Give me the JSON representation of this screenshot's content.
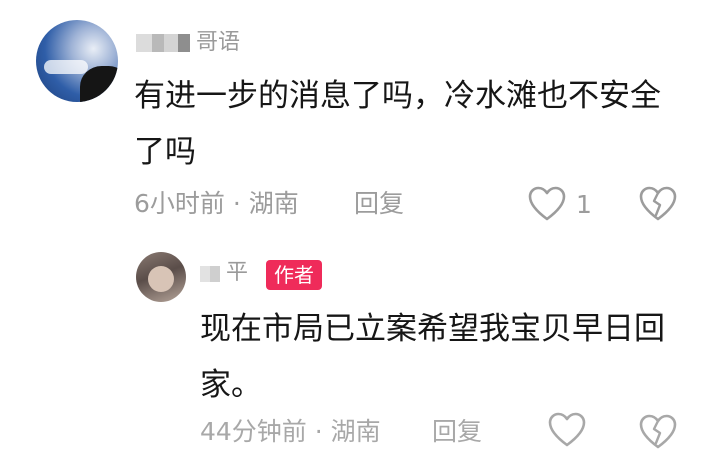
{
  "top_comment": {
    "username_visible": "哥语",
    "text": "有进一步的消息了吗，冷水滩也不安全了吗",
    "meta": "6小时前 · 湖南",
    "reply_label": "回复",
    "like_count": "1"
  },
  "reply_comment": {
    "username_visible": "平",
    "author_badge": "作者",
    "text": "现在市局已立案希望我宝贝早日回家。",
    "meta": "44分钟前 · 湖南",
    "reply_label": "回复"
  },
  "icons": {
    "like": "heart-outline-icon",
    "dislike": "broken-heart-icon"
  },
  "colors": {
    "text_primary": "#161616",
    "text_secondary": "#9c9c9c",
    "author_badge_bg": "#ef2b5a"
  }
}
